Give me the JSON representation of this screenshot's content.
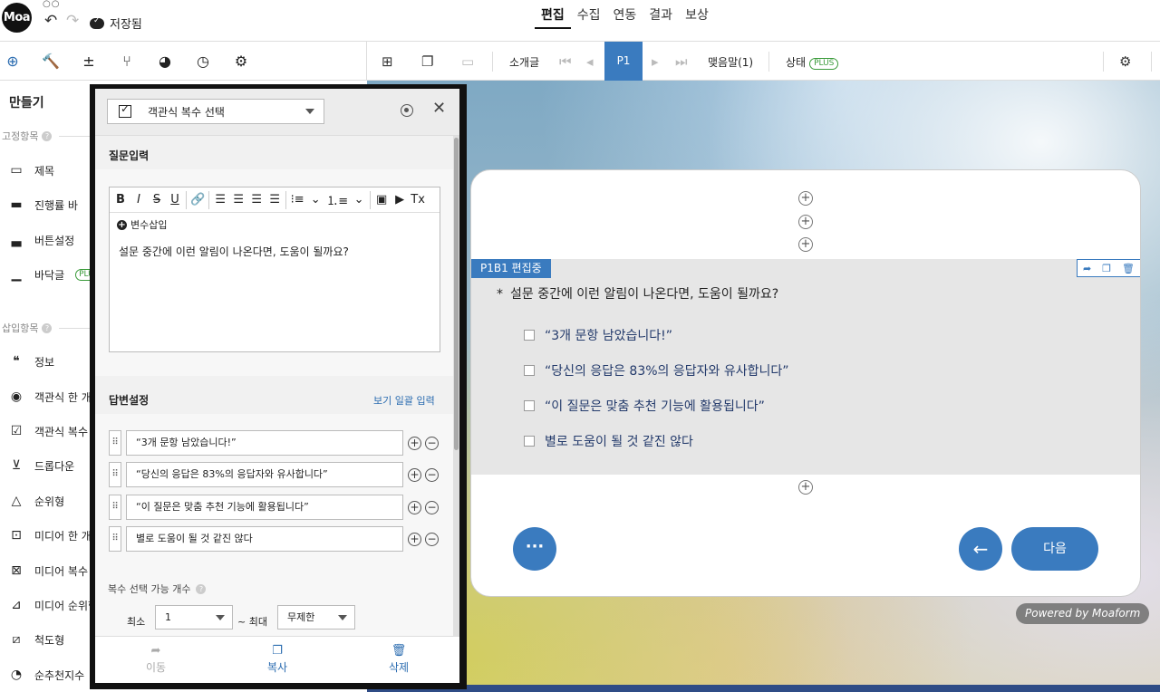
{
  "topbar": {
    "logo": "Moa",
    "save_status": "저장됨",
    "tabs": [
      {
        "label": "편집"
      },
      {
        "label": "수집"
      },
      {
        "label": "연동"
      },
      {
        "label": "결과"
      },
      {
        "label": "보상"
      }
    ]
  },
  "left_toolbar": {
    "icons": [
      "add-circle-icon",
      "hammer-icon",
      "calculator-icon",
      "branch-icon",
      "pie-chart-icon",
      "clock-icon",
      "gear-icon"
    ]
  },
  "page_toolbar": {
    "intro_label": "소개글",
    "page_label": "P1",
    "closing_label": "맺음말(1)",
    "status_label": "상태",
    "plus_badge": "PLUS"
  },
  "sidebar": {
    "title": "만들기",
    "fixed_section": "고정항목",
    "fixed_items": [
      {
        "label": "제목",
        "icon": "title-icon"
      },
      {
        "label": "진행률 바",
        "icon": "progress-icon"
      },
      {
        "label": "버튼설정",
        "icon": "button-icon"
      },
      {
        "label": "바닥글",
        "icon": "footer-icon",
        "badge": "PLU"
      }
    ],
    "insert_section": "삽입항목",
    "insert_items": [
      {
        "label": "정보",
        "icon": "quote-icon"
      },
      {
        "label": "객관식 한 개",
        "icon": "radio-icon"
      },
      {
        "label": "객관식 복수",
        "icon": "checkbox-icon"
      },
      {
        "label": "드롭다운",
        "icon": "dropdown-icon"
      },
      {
        "label": "순위형",
        "icon": "triangle-icon"
      },
      {
        "label": "미디어 한 개",
        "icon": "media-radio-icon"
      },
      {
        "label": "미디어 복수",
        "icon": "media-check-icon"
      },
      {
        "label": "미디어 순위형",
        "icon": "media-rank-icon"
      },
      {
        "label": "척도형",
        "icon": "ruler-icon"
      },
      {
        "label": "순추천지수",
        "icon": "gauge-icon"
      }
    ]
  },
  "panel": {
    "type_label": "객관식 복수 선택",
    "question_section": "질문입력",
    "var_insert": "변수삽입",
    "question_text": "설문 중간에 이런 알림이 나온다면, 도움이 될까요?",
    "answer_section": "답변설정",
    "bulk_link": "보기 일괄 입력",
    "answers": [
      "“3개 문항 남았습니다!”",
      "“당신의 응답은 83%의 응답자와 유사합니다”",
      "“이 질문은 맞춤 추천 기능에 활용됩니다”",
      "별로 도움이 될 것 같진 않다"
    ],
    "multi_label": "복수 선택 가능 개수",
    "min_label": "최소",
    "min_value": "1",
    "max_label": "~ 최대",
    "max_value": "무제한",
    "footer": {
      "move": "이동",
      "copy": "복사",
      "delete": "삭제"
    }
  },
  "card": {
    "edit_tag": "P1B1 편집중",
    "required_mark": "*",
    "question": "설문 중간에 이런 알림이 나온다면, 도움이 될까요?",
    "options": [
      "“3개 문항 남았습니다!”",
      "“당신의 응답은 83%의 응답자와 유사합니다”",
      "“이 질문은 맞춤 추천 기능에 활용됩니다”",
      "별로 도움이 될 것 같진 않다"
    ],
    "more_label": "···",
    "next_label": "다음"
  },
  "powered_by": "Powered by Moaform",
  "colors": {
    "accent": "#3a7bbf",
    "plus_green": "#3a9b3a",
    "option_text": "#233a6b"
  }
}
